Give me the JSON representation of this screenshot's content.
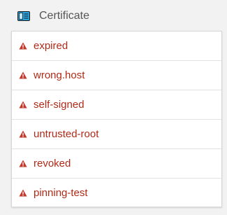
{
  "header": {
    "title": "Certificate",
    "icon": "certificate-card-icon",
    "icon_color": "#1f8fd0"
  },
  "items": [
    {
      "label": "expired",
      "icon": "warning-icon"
    },
    {
      "label": "wrong.host",
      "icon": "warning-icon"
    },
    {
      "label": "self-signed",
      "icon": "warning-icon"
    },
    {
      "label": "untrusted-root",
      "icon": "warning-icon"
    },
    {
      "label": "revoked",
      "icon": "warning-icon"
    },
    {
      "label": "pinning-test",
      "icon": "warning-icon"
    }
  ],
  "colors": {
    "link": "#b02a17",
    "warning": "#c0392b",
    "background": "#f2f2f2"
  }
}
